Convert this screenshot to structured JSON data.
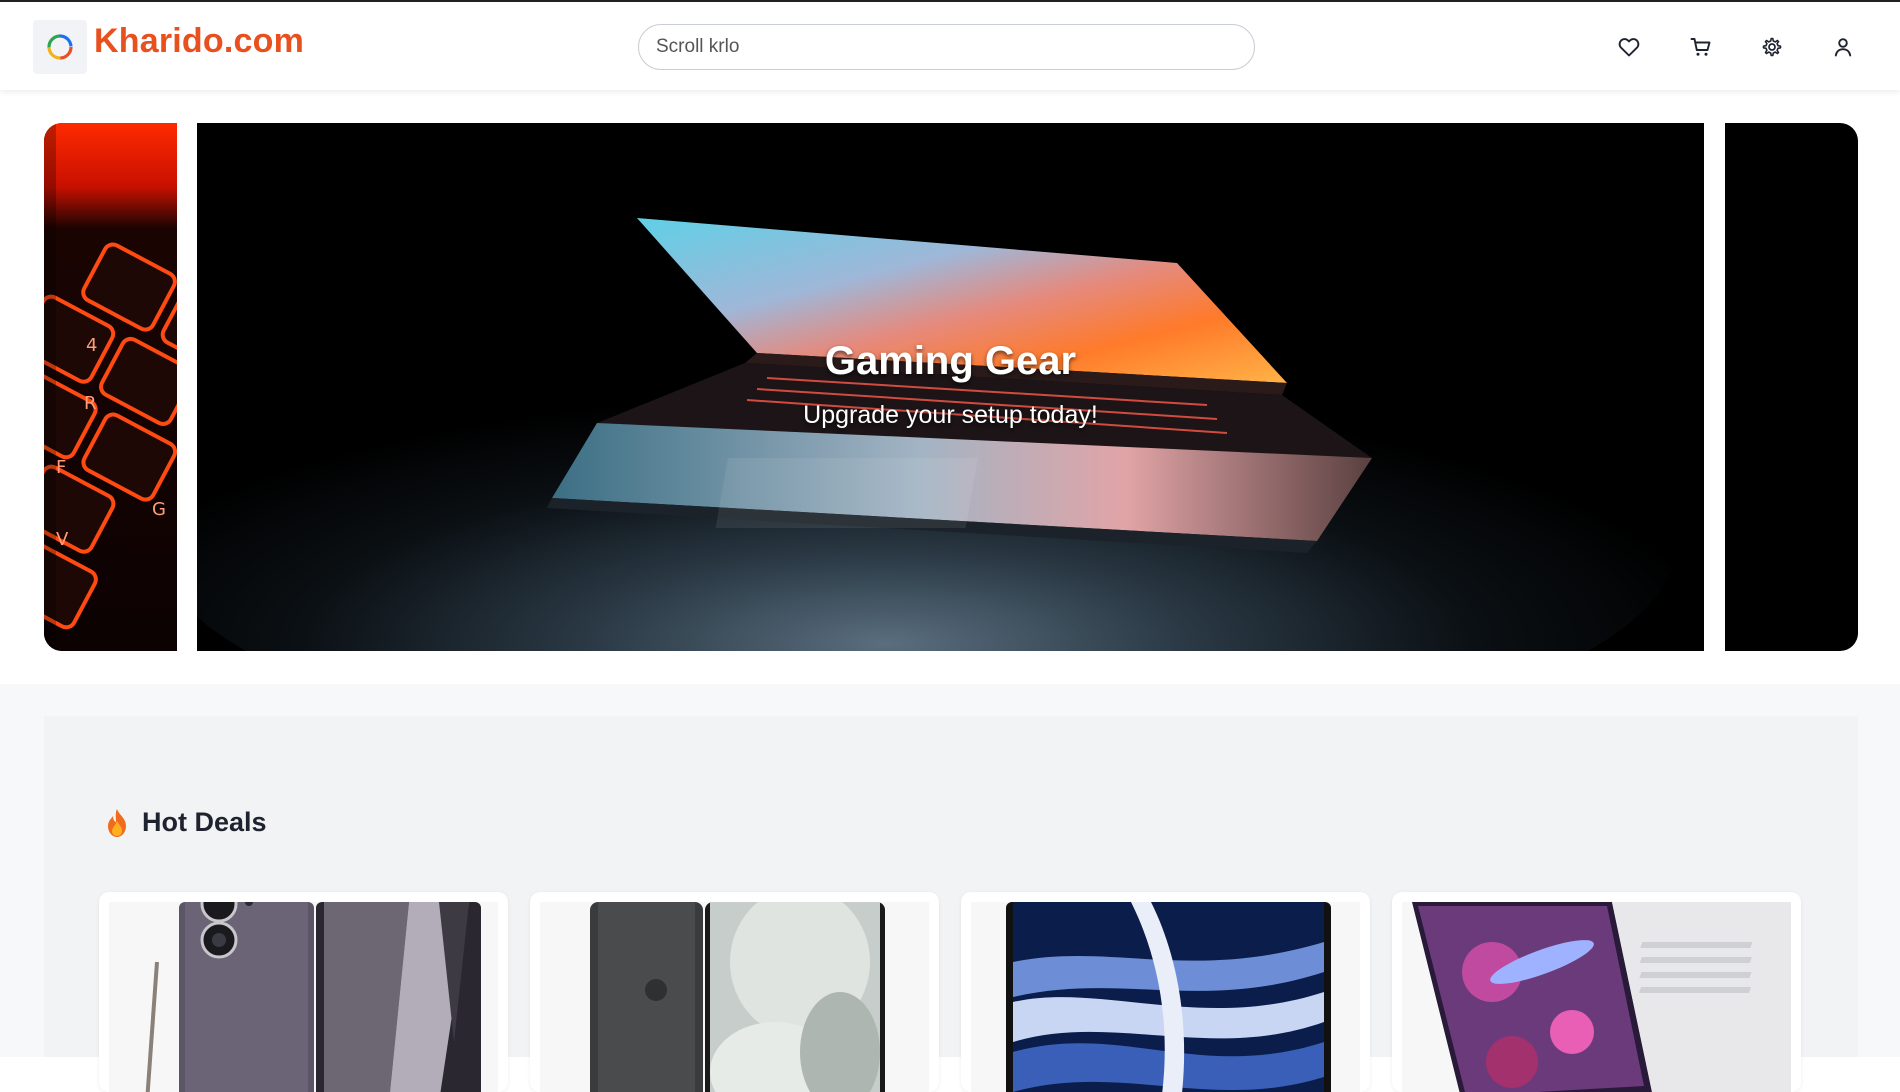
{
  "header": {
    "brand": "Kharido.com",
    "search_placeholder": "Scroll krlo",
    "icons": [
      "heart-icon",
      "cart-icon",
      "gear-icon",
      "user-icon"
    ]
  },
  "hero": {
    "title": "Gaming Gear",
    "subtitle": "Upgrade your setup today!"
  },
  "deals": {
    "title": "Hot Deals",
    "icon": "fire-icon"
  },
  "colors": {
    "brand": "#e8501e",
    "panel_bg": "#f2f3f5"
  }
}
